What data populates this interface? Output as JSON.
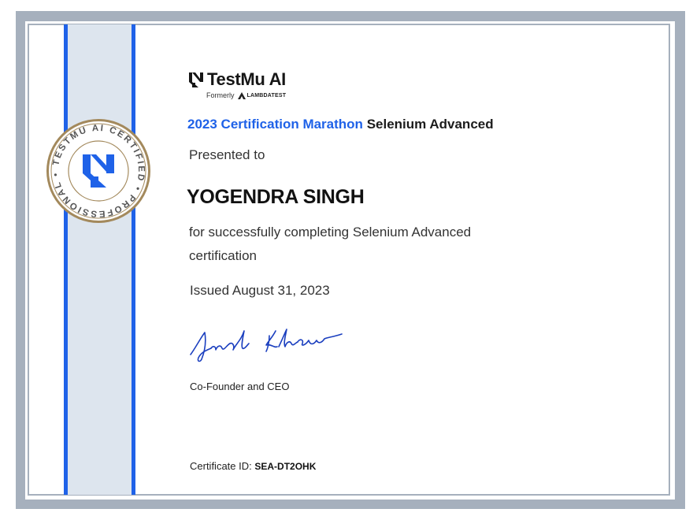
{
  "brand": {
    "name": "TestMu AI",
    "formerly_label": "Formerly",
    "former_name": "LAMBDATEST"
  },
  "seal": {
    "text": "TESTMU AI CERTIFIED • PROFESSIONAL •",
    "accent_color": "#1f62e8",
    "gold_color": "#a3895c"
  },
  "certificate": {
    "event": "2023 Certification Marathon",
    "course": "Selenium Advanced",
    "presented_label": "Presented to",
    "recipient": "YOGENDRA SINGH",
    "description": "for successfully completing Selenium Advanced certification",
    "issued": "Issued August 31, 2023",
    "signer_title": "Co-Founder and CEO",
    "id_label": "Certificate ID:",
    "id_value": "SEA-DT2OHK"
  },
  "colors": {
    "accent": "#1f62e8",
    "frame": "#a6b0bd",
    "ribbon": "#dde5ee"
  }
}
